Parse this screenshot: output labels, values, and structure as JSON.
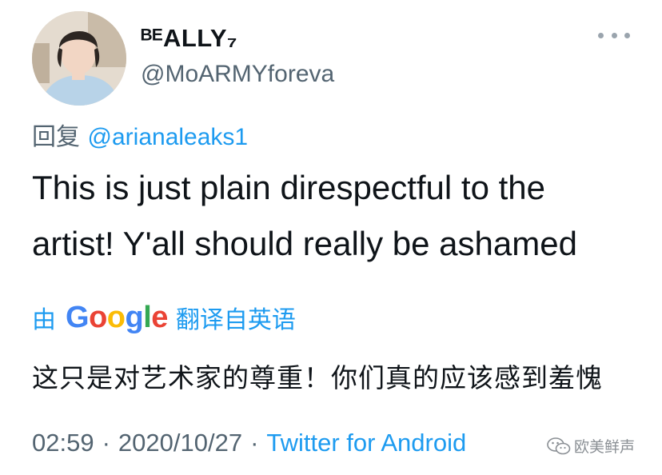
{
  "user": {
    "display_name": "ᴮᴱALLY₇",
    "handle": "@MoARMYforeva",
    "avatar_icon": "profile-photo"
  },
  "reply": {
    "prefix": "回复 ",
    "mention": "@arianaleaks1"
  },
  "tweet": {
    "lines": [
      "This is just plain direspectful to the",
      "artist! Y'all should really be ashamed"
    ]
  },
  "translation": {
    "by_label": "由",
    "provider": "Google",
    "action_label": "翻译自英语",
    "translated_text": "这只是对艺术家的尊重！你们真的应该感到羞愧"
  },
  "meta": {
    "time": "02:59",
    "separator": "·",
    "date": "2020/10/27",
    "source": "Twitter for Android"
  },
  "watermark": {
    "text": "欧美鲜声",
    "icon": "wechat-icon"
  },
  "colors": {
    "link": "#1d9bf0",
    "secondary_text": "#536471",
    "primary_text": "#0f1419"
  }
}
